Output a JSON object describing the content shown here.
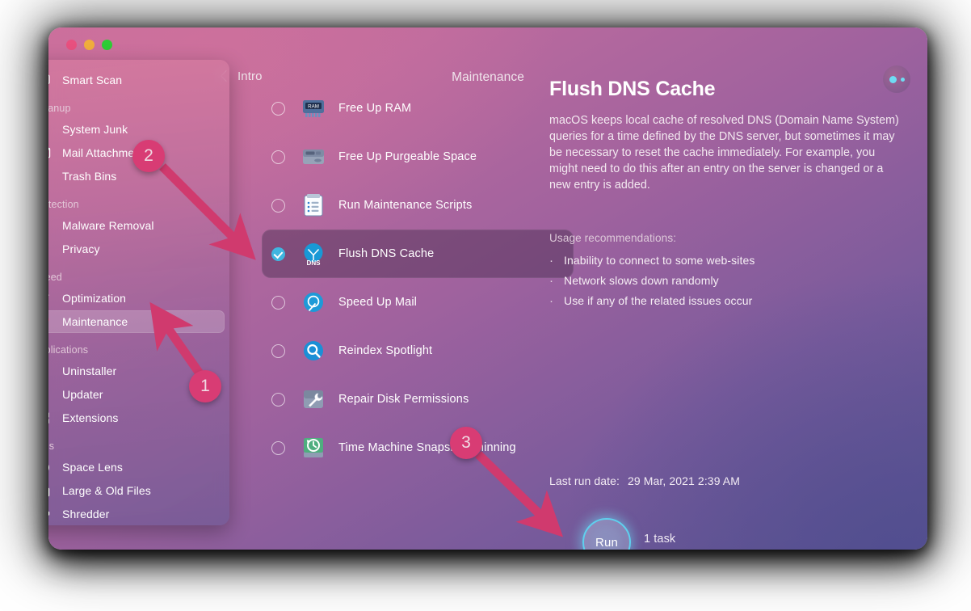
{
  "window": {
    "back_label": "Intro",
    "title": "Maintenance",
    "avatar_icon": "user-avatar-icon",
    "traffic_lights": [
      "close-button",
      "minimize-button",
      "zoom-button"
    ]
  },
  "sidebar": {
    "top_items": [
      {
        "label": "Smart Scan",
        "icon": "smart-scan-icon",
        "selected": false
      }
    ],
    "groups": [
      {
        "title": "Cleanup",
        "items": [
          {
            "label": "System Junk",
            "icon": "system-junk-icon",
            "selected": false
          },
          {
            "label": "Mail Attachments",
            "icon": "mail-attachments-icon",
            "selected": false
          },
          {
            "label": "Trash Bins",
            "icon": "trash-bins-icon",
            "selected": false
          }
        ]
      },
      {
        "title": "Protection",
        "items": [
          {
            "label": "Malware Removal",
            "icon": "malware-removal-icon",
            "selected": false
          },
          {
            "label": "Privacy",
            "icon": "privacy-icon",
            "selected": false
          }
        ]
      },
      {
        "title": "Speed",
        "items": [
          {
            "label": "Optimization",
            "icon": "optimization-icon",
            "selected": false
          },
          {
            "label": "Maintenance",
            "icon": "maintenance-icon",
            "selected": true
          }
        ]
      },
      {
        "title": "Applications",
        "items": [
          {
            "label": "Uninstaller",
            "icon": "uninstaller-icon",
            "selected": false
          },
          {
            "label": "Updater",
            "icon": "updater-icon",
            "selected": false
          },
          {
            "label": "Extensions",
            "icon": "extensions-icon",
            "selected": false
          }
        ]
      },
      {
        "title": "Files",
        "items": [
          {
            "label": "Space Lens",
            "icon": "space-lens-icon",
            "selected": false
          },
          {
            "label": "Large & Old Files",
            "icon": "large-old-files-icon",
            "selected": false
          },
          {
            "label": "Shredder",
            "icon": "shredder-icon",
            "selected": false
          }
        ]
      }
    ]
  },
  "tasks": [
    {
      "label": "Free Up RAM",
      "icon": "ram-chip-icon",
      "checked": false,
      "active": false
    },
    {
      "label": "Free Up Purgeable Space",
      "icon": "hard-drive-icon",
      "checked": false,
      "active": false
    },
    {
      "label": "Run Maintenance Scripts",
      "icon": "clipboard-icon",
      "checked": false,
      "active": false
    },
    {
      "label": "Flush DNS Cache",
      "icon": "dns-icon",
      "checked": true,
      "active": true
    },
    {
      "label": "Speed Up Mail",
      "icon": "mail-speed-icon",
      "checked": false,
      "active": false
    },
    {
      "label": "Reindex Spotlight",
      "icon": "spotlight-search-icon",
      "checked": false,
      "active": false
    },
    {
      "label": "Repair Disk Permissions",
      "icon": "disk-wrench-icon",
      "checked": false,
      "active": false
    },
    {
      "label": "Time Machine Snapshot Thinning",
      "icon": "time-machine-icon",
      "checked": false,
      "active": false
    }
  ],
  "detail": {
    "title": "Flush DNS Cache",
    "description": "macOS keeps local cache of resolved DNS (Domain Name System) queries for a time defined by the DNS server, but sometimes it may be necessary to reset the cache immediately. For example, you might need to do this after an entry on the server is changed or a new entry is added.",
    "recommendations_title": "Usage recommendations:",
    "recommendations": [
      "Inability to connect to some web-sites",
      "Network slows down randomly",
      "Use if any of the related issues occur"
    ],
    "last_run_label": "Last run date:",
    "last_run_value": "29 Mar, 2021 2:39 AM"
  },
  "footer": {
    "run_label": "Run",
    "task_count_label": "1 task"
  },
  "annotations": [
    {
      "number": "1",
      "target": "sidebar-item-maintenance"
    },
    {
      "number": "2",
      "target": "task-checkbox-flush-dns-cache"
    },
    {
      "number": "3",
      "target": "run-button"
    }
  ],
  "colors": {
    "accent_cyan": "#3fb6e0",
    "annotation_pink": "#d83c74",
    "window_pink": "#c76d9c",
    "window_purple": "#5b5493"
  }
}
